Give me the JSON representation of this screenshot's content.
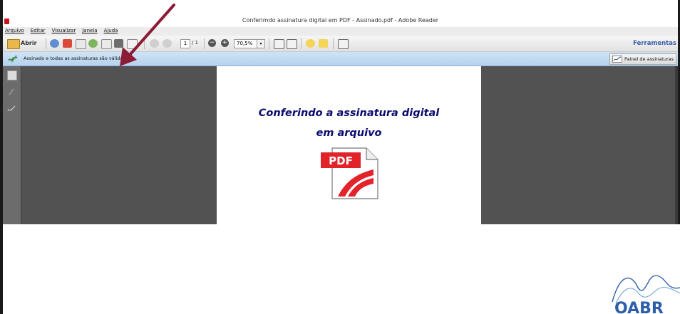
{
  "window": {
    "title": "Conferimdo assinatura digital em PDF - Assinado.pdf - Adobe Reader"
  },
  "menu": [
    "Arquivo",
    "Editar",
    "Visualizar",
    "Janela",
    "Ajuda"
  ],
  "toolbar": {
    "open_label": "Abrir",
    "page_current": "1",
    "page_total": "/ 1",
    "zoom_value": "70,5%",
    "tools_label": "Ferramentas"
  },
  "signature_bar": {
    "message": "Assinado e todas as assinaturas são válidas.",
    "panel_button": "Painel de assinaturas"
  },
  "document": {
    "line1": "Conferindo a assinatura digital",
    "line2": "em arquivo",
    "pdf_badge": "PDF"
  },
  "logo": {
    "text": "OABR"
  },
  "colors": {
    "accent_blue": "#3b5ea8",
    "signature_bar": "#c2dbf1",
    "document_text": "#0a0a6e",
    "pdf_red": "#e2232a",
    "annotation_arrow": "#8b1c34",
    "viewer_background": "#525252"
  },
  "icons": {
    "app": "adobe-reader-icon",
    "open": "folder-icon",
    "signature": "signature-valid-icon",
    "panel": "signature-pen-icon",
    "sidebar": [
      "pages-icon",
      "attachments-icon",
      "signatures-icon"
    ],
    "document": "pdf-file-icon",
    "annotation": "red-arrow-annotation"
  }
}
